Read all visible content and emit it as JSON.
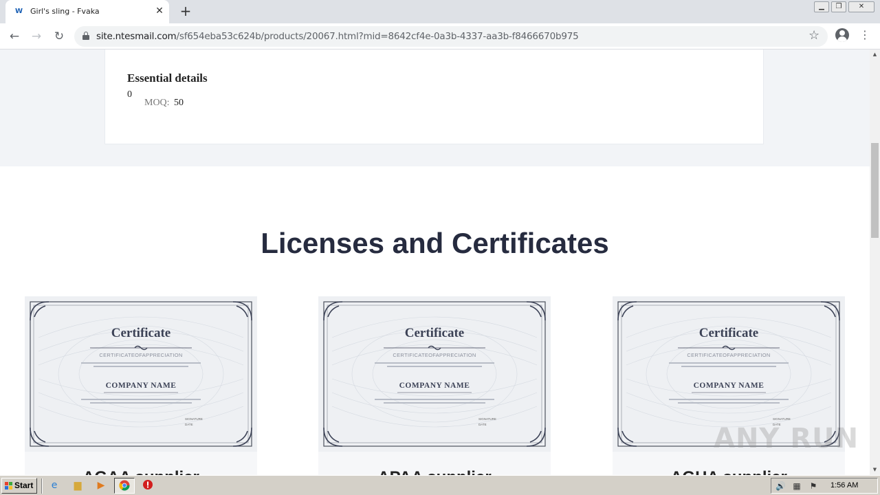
{
  "browser": {
    "tab": {
      "title": "Girl's sling - Fvaka",
      "favicon": "fvaka-logo"
    },
    "address": {
      "host": "site.ntesmail.com",
      "path": "/sf654eba53c624b/products/20067.html?mid=8642cf4e-0a3b-4337-aa3b-f8466670b975"
    },
    "icons": {
      "close": "✕",
      "newtab": "+",
      "back": "←",
      "forward": "→",
      "reload": "↻",
      "star": "☆",
      "menu": "⋮",
      "minimize": "▁",
      "restore": "❐",
      "win_close": "✕"
    }
  },
  "details": {
    "title": "Essential details",
    "index": "0",
    "moq_label": "MOQ:",
    "moq_value": "50"
  },
  "certificates": {
    "heading": "Licenses and Certificates",
    "items": [
      {
        "cert_title": "Certificate",
        "cert_subtitle": "CERTIFICATEOFAPPRECIATION",
        "company": "COMPANY NAME",
        "signature": "SIGNATURE",
        "date": "DATE",
        "caption": "AGAA supplier"
      },
      {
        "cert_title": "Certificate",
        "cert_subtitle": "CERTIFICATEOFAPPRECIATION",
        "company": "COMPANY NAME",
        "signature": "SIGNATURE",
        "date": "DATE",
        "caption": "APAA supplier"
      },
      {
        "cert_title": "Certificate",
        "cert_subtitle": "CERTIFICATEOFAPPRECIATION",
        "company": "COMPANY NAME",
        "signature": "SIGNATURE",
        "date": "DATE",
        "caption": "AGHA supplier"
      }
    ]
  },
  "watermark": "ANY RUN",
  "scrollbar": {
    "up": "▲",
    "down": "▼"
  },
  "taskbar": {
    "start_label": "Start",
    "clock": "1:56 AM",
    "icons": [
      "ie-icon",
      "explorer-icon",
      "media-player-icon",
      "chrome-icon",
      "stop-icon"
    ]
  }
}
